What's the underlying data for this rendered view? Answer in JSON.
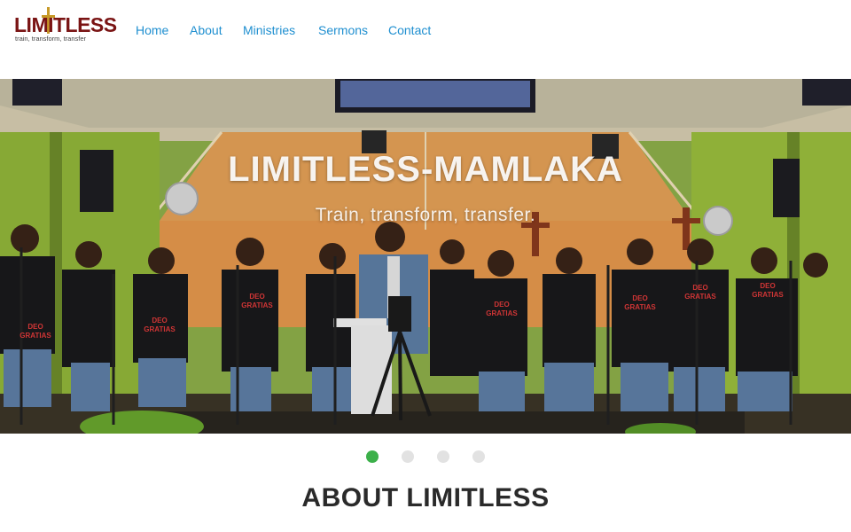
{
  "header": {
    "logo": {
      "wordmark": "LIMITLESS",
      "tagline": "train, transform, transfer"
    },
    "nav": [
      {
        "label": "Home"
      },
      {
        "label": "About"
      },
      {
        "label": "Ministries"
      },
      {
        "label": "Sermons"
      },
      {
        "label": "Contact"
      }
    ]
  },
  "hero": {
    "title": "LIMITLESS-MAMLAKA",
    "subtitle": "Train, transform, transfer.",
    "image_alt": "Worship team in black DEO GRATIAS t-shirts standing on a stage",
    "shirt_text": [
      "DEO",
      "GRATIAS"
    ]
  },
  "slider": {
    "slide_count": 4,
    "active_index": 0
  },
  "about": {
    "heading": "ABOUT LIMITLESS"
  },
  "colors": {
    "nav_link": "#1f8fd0",
    "active_dot": "#3cb04a",
    "inactive_dot": "#e2e2e2",
    "logo_red": "#7a1414",
    "logo_gold": "#c79a28"
  }
}
